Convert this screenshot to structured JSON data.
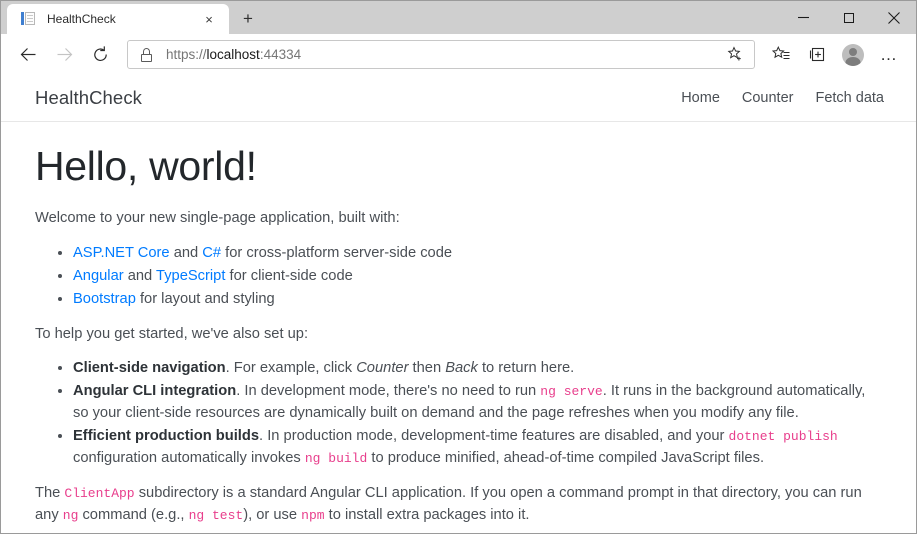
{
  "browser": {
    "tab": {
      "title": "HealthCheck",
      "favicon": "page-icon",
      "close_label": "×"
    },
    "new_tab_label": "+",
    "window_controls": {
      "minimize": "—",
      "maximize": "maximize-icon",
      "close": "✕"
    },
    "toolbar": {
      "back": "back-arrow-icon",
      "forward": "forward-arrow-icon",
      "refresh": "refresh-icon",
      "url_scheme": "https://",
      "url_host": "localhost",
      "url_port": ":44334",
      "lock": "lock-icon",
      "favorite": "star-add-icon",
      "favorites_list": "favorites-list-icon",
      "collections": "collections-icon",
      "profile": "profile-avatar",
      "settings": "…"
    }
  },
  "page": {
    "navbar": {
      "brand": "HealthCheck",
      "links": [
        {
          "label": "Home"
        },
        {
          "label": "Counter"
        },
        {
          "label": "Fetch data"
        }
      ]
    },
    "heading": "Hello, world!",
    "intro": "Welcome to your new single-page application, built with:",
    "tech_list": [
      {
        "link1": "ASP.NET Core",
        "mid": " and ",
        "link2": "C#",
        "tail": " for cross-platform server-side code"
      },
      {
        "link1": "Angular",
        "mid": " and ",
        "link2": "TypeScript",
        "tail": " for client-side code"
      },
      {
        "link1": "Bootstrap",
        "mid": "",
        "link2": "",
        "tail": " for layout and styling"
      }
    ],
    "setup_intro": "To help you get started, we've also set up:",
    "features": {
      "nav": {
        "term": "Client-side navigation",
        "part1": ". For example, click ",
        "em1": "Counter",
        "part2": " then ",
        "em2": "Back",
        "part3": " to return here."
      },
      "cli": {
        "term": "Angular CLI integration",
        "part1": ". In development mode, there's no need to run ",
        "code1": "ng serve",
        "part2": ". It runs in the background automatically, so your client-side resources are dynamically built on demand and the page refreshes when you modify any file."
      },
      "builds": {
        "term": "Efficient production builds",
        "part1": ". In production mode, development-time features are disabled, and your ",
        "code1": "dotnet publish",
        "part2": " configuration automatically invokes ",
        "code2": "ng build",
        "part3": " to produce minified, ahead-of-time compiled JavaScript files."
      }
    },
    "closing": {
      "part1": "The ",
      "code1": "ClientApp",
      "part2": " subdirectory is a standard Angular CLI application. If you open a command prompt in that directory, you can run any ",
      "code2": "ng",
      "part3": " command (e.g., ",
      "code3": "ng test",
      "part4": "), or use ",
      "code4": "npm",
      "part5": " to install extra packages into it."
    }
  },
  "colors": {
    "link": "#007bff",
    "code": "#e83e8c",
    "text": "#4a4f55",
    "tabstrip": "#cfcfcf"
  }
}
